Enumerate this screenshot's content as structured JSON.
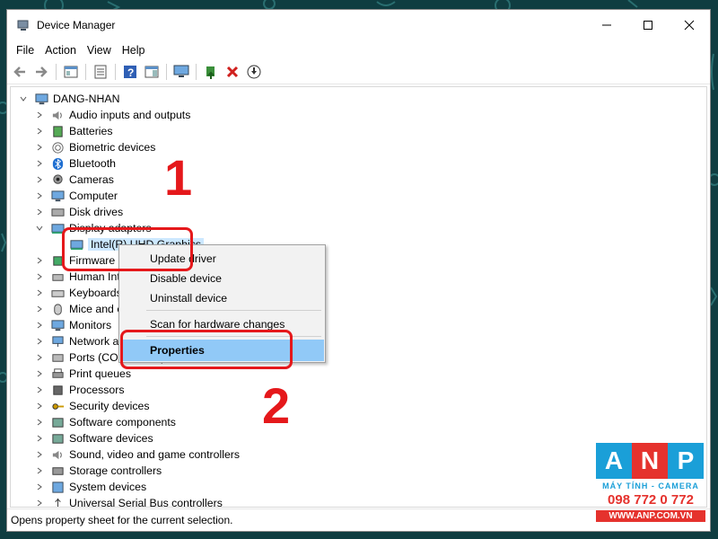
{
  "window": {
    "title": "Device Manager",
    "controls": {
      "minimize": "minimize",
      "maximize": "maximize",
      "close": "close"
    }
  },
  "menu": [
    "File",
    "Action",
    "View",
    "Help"
  ],
  "toolbar_icons": [
    "back-icon",
    "forward-icon",
    "properties-pane-icon",
    "device-list-icon",
    "help-icon",
    "view-icon",
    "monitor-icon",
    "update-driver-icon",
    "uninstall-icon",
    "download-icon"
  ],
  "tree": {
    "root": "DANG-NHAN",
    "items": [
      {
        "label": "Audio inputs and outputs",
        "icon": "speaker-icon"
      },
      {
        "label": "Batteries",
        "icon": "battery-icon"
      },
      {
        "label": "Biometric devices",
        "icon": "fingerprint-icon"
      },
      {
        "label": "Bluetooth",
        "icon": "bluetooth-icon"
      },
      {
        "label": "Cameras",
        "icon": "camera-icon"
      },
      {
        "label": "Computer",
        "icon": "computer-icon"
      },
      {
        "label": "Disk drives",
        "icon": "disk-icon"
      },
      {
        "label": "Display adapters",
        "icon": "display-icon",
        "expanded": true
      },
      {
        "label": "Intel(R) UHD Graphics",
        "icon": "display-icon",
        "child": true,
        "selected": true
      },
      {
        "label": "Firmware",
        "icon": "chip-icon"
      },
      {
        "label": "Human Inte",
        "icon": "hid-icon"
      },
      {
        "label": "Keyboards",
        "icon": "keyboard-icon"
      },
      {
        "label": "Mice and o",
        "icon": "mouse-icon"
      },
      {
        "label": "Monitors",
        "icon": "monitor-icon"
      },
      {
        "label": "Network ad",
        "icon": "network-icon"
      },
      {
        "label": "Ports (COM & LPT)",
        "icon": "port-icon"
      },
      {
        "label": "Print queues",
        "icon": "printer-icon"
      },
      {
        "label": "Processors",
        "icon": "cpu-icon"
      },
      {
        "label": "Security devices",
        "icon": "key-icon"
      },
      {
        "label": "Software components",
        "icon": "software-icon"
      },
      {
        "label": "Software devices",
        "icon": "software-icon"
      },
      {
        "label": "Sound, video and game controllers",
        "icon": "speaker-icon"
      },
      {
        "label": "Storage controllers",
        "icon": "storage-icon"
      },
      {
        "label": "System devices",
        "icon": "system-icon"
      },
      {
        "label": "Universal Serial Bus controllers",
        "icon": "usb-icon"
      }
    ]
  },
  "context_menu": {
    "items": [
      {
        "label": "Update driver"
      },
      {
        "label": "Disable device"
      },
      {
        "label": "Uninstall device"
      },
      {
        "label": "Scan for hardware changes"
      },
      {
        "label": "Properties",
        "highlighted": true
      }
    ]
  },
  "status": "Opens property sheet for the current selection.",
  "annotations": {
    "step1": "1",
    "step2": "2",
    "color": "#e5181b"
  },
  "logo": {
    "letters": [
      "A",
      "N",
      "P"
    ],
    "letter_colors": [
      "#1a9fd8",
      "#e5322d",
      "#1a9fd8"
    ],
    "tagline": "MÁY TÍNH - CAMERA",
    "phone": "098 772 0 772",
    "website": "WWW.ANP.COM.VN"
  }
}
